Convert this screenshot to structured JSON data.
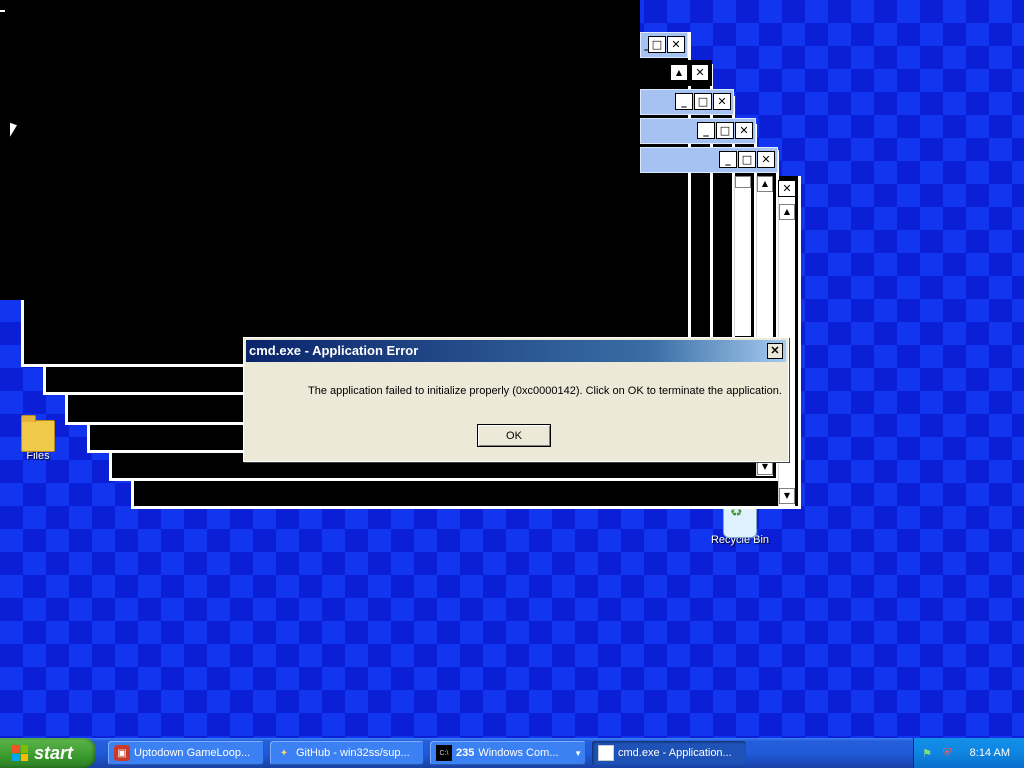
{
  "desktop": {
    "icons": [
      {
        "label": "Files",
        "icon": "folder-icon"
      },
      {
        "label": "Recycle Bin",
        "icon": "recycle-bin-icon"
      }
    ]
  },
  "dialog": {
    "title": "cmd.exe - Application Error",
    "message": "The application failed to initialize properly (0xc0000142). Click on OK to terminate the application.",
    "ok_label": "OK",
    "close_glyph": "✕"
  },
  "window_controls": {
    "minimize": "_",
    "maximize": "□",
    "close": "✕"
  },
  "taskbar": {
    "start_label": "start",
    "items": [
      {
        "label": "Uptodown GameLoop...",
        "icon": "gameloop-icon"
      },
      {
        "label": "GitHub - win32ss/sup...",
        "icon": "browser-icon"
      },
      {
        "count": "235",
        "label": "Windows Com...",
        "icon": "console-icon"
      },
      {
        "label": "cmd.exe - Application...",
        "icon": "window-icon"
      }
    ],
    "tray": {
      "time": "8:14 AM"
    }
  },
  "colors": {
    "desktop_blue": "#0a1fd6",
    "title_blue": "#0a246a",
    "taskbar_blue": "#245edb",
    "start_green": "#3a9a2e"
  }
}
